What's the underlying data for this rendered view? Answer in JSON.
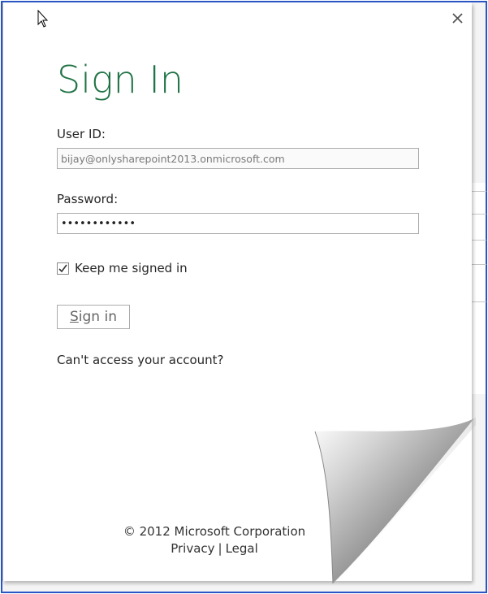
{
  "dialog": {
    "title": "Sign In",
    "userid_label": "User ID:",
    "userid_value": "bijay@onlysharepoint2013.onmicrosoft.com",
    "password_label": "Password:",
    "password_value": "••••••••••••",
    "keep_signed_in_label": "Keep me signed in",
    "keep_signed_in_checked": true,
    "signin_first": "S",
    "signin_rest": "ign in",
    "cant_access_link": "Can't access your account?"
  },
  "footer": {
    "copyright": "© 2012 Microsoft Corporation",
    "privacy_link": "Privacy",
    "separator": "|",
    "legal_link": "Legal"
  },
  "icons": {
    "close": "close-icon",
    "checkmark": "checkmark-icon",
    "cursor": "mouse-pointer-icon"
  },
  "colors": {
    "accent": "#217346",
    "frame": "#2a55c4",
    "text": "#262626"
  }
}
